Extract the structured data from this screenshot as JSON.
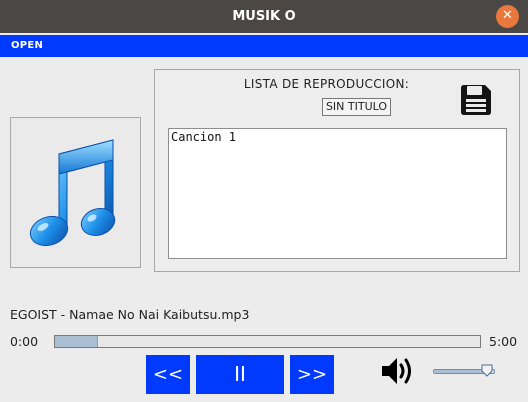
{
  "window": {
    "title": "MUSIK O"
  },
  "menu": {
    "open_label": "OPEN"
  },
  "playlist": {
    "header": "LISTA DE REPRODUCCION:",
    "name": "SIN TITULO",
    "songs": [
      "Cancion 1"
    ]
  },
  "player": {
    "now_playing": "EGOIST - Namae No Nai Kaibutsu.mp3",
    "current_time": "0:00",
    "total_time": "5:00",
    "progress": 0.1,
    "volume": 0.85,
    "prev_label": "<<",
    "pause_label": "II",
    "next_label": ">>"
  },
  "icons": {
    "album_art": "music-note-icon",
    "save": "floppy-disk-icon",
    "volume": "speaker-icon",
    "close": "close-icon"
  },
  "colors": {
    "accent": "#0039ff",
    "titlebar": "#4a4744",
    "close_button": "#e9773e",
    "progress_fill": "#a9bdd3"
  }
}
